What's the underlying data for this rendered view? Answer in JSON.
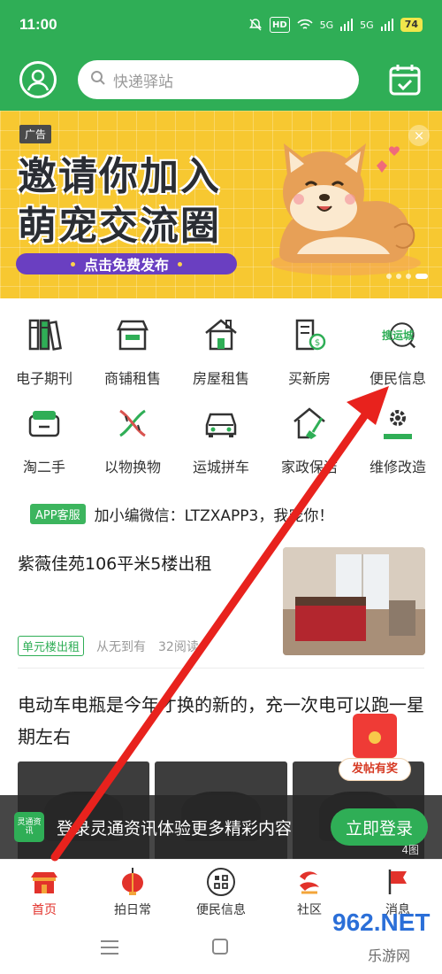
{
  "status_bar": {
    "time": "11:00",
    "hd": "HD",
    "signal1": "5G",
    "signal2": "5G",
    "battery": "74"
  },
  "header": {
    "search_placeholder": "快递驿站",
    "icons": [
      "user-avatar-icon",
      "search-icon",
      "calendar-check-icon"
    ]
  },
  "banner": {
    "ad_tag": "广告",
    "line1": "邀请你加入",
    "line2": "萌宠交流圈",
    "cta": "点击免费发布",
    "close": "×"
  },
  "grid": [
    {
      "label": "电子期刊",
      "icon": "books-icon"
    },
    {
      "label": "商铺租售",
      "icon": "shop-icon"
    },
    {
      "label": "房屋租售",
      "icon": "house-icon"
    },
    {
      "label": "买新房",
      "icon": "building-money-icon"
    },
    {
      "label": "便民信息",
      "icon": "search-yuncheng-icon",
      "logo_text": "搜运城"
    },
    {
      "label": "淘二手",
      "icon": "shopping-basket-icon"
    },
    {
      "label": "以物换物",
      "icon": "exchange-icon"
    },
    {
      "label": "运城拼车",
      "icon": "car-icon"
    },
    {
      "label": "家政保洁",
      "icon": "house-broom-icon"
    },
    {
      "label": "维修改造",
      "icon": "repair-gear-icon"
    }
  ],
  "notice": {
    "tag": "APP客服",
    "text": "加小编微信：LTZXAPP3，我宠你！"
  },
  "news1": {
    "title": "紫薇佳苑106平米5楼出租",
    "tag": "单元楼出租",
    "source": "从无到有",
    "reads": "32阅读"
  },
  "news2": {
    "title": "电动车电瓶是今年才换的新的，充一次电可以跑一星期左右",
    "image_count": "4图"
  },
  "redpacket": {
    "label": "发帖有奖"
  },
  "login_bar": {
    "logo_text": "灵通资讯",
    "text": "登录灵通资讯体验更多精彩内容",
    "button": "立即登录"
  },
  "bottom_nav": [
    {
      "label": "首页",
      "icon": "home-palace-icon",
      "active": true
    },
    {
      "label": "拍日常",
      "icon": "lantern-icon",
      "active": false
    },
    {
      "label": "便民信息",
      "icon": "grid-circle-icon",
      "active": false
    },
    {
      "label": "社区",
      "icon": "community-icon",
      "active": false
    },
    {
      "label": "消息",
      "icon": "flag-icon",
      "active": false
    }
  ],
  "watermark": {
    "main": "962.NET",
    "sub": "乐游网"
  },
  "colors": {
    "brand_green": "#2fae56",
    "banner_yellow": "#f7c831",
    "cta_purple": "#6a3fc1",
    "annotation_red": "#e8221d"
  }
}
